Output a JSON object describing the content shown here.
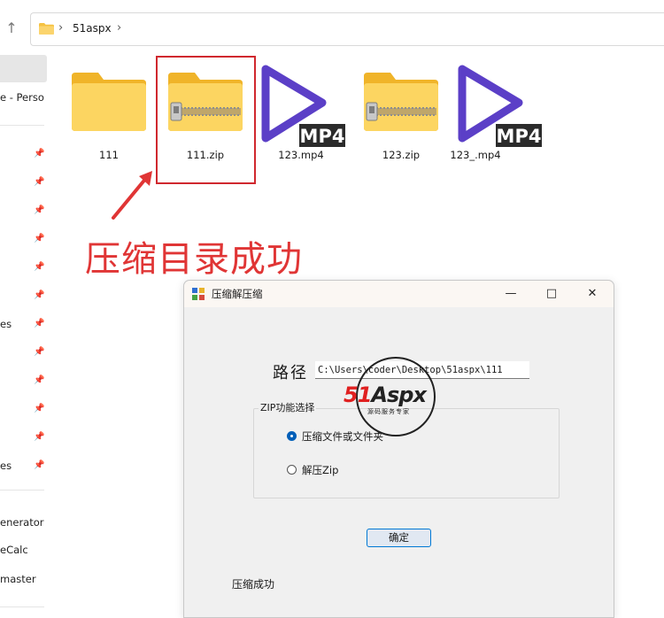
{
  "explorer": {
    "breadcrumb": "51aspx",
    "folder_color": "#f5c242",
    "sidebar": {
      "truncated_texts": [
        "e - Perso",
        "es",
        "es",
        "enerator",
        "eCalc",
        "master"
      ]
    },
    "files": [
      {
        "name": "111",
        "type": "folder"
      },
      {
        "name": "111.zip",
        "type": "zip-folder"
      },
      {
        "name": "123.mp4",
        "type": "mp4"
      },
      {
        "name": "123.zip",
        "type": "zip-folder"
      },
      {
        "name": "123_.mp4",
        "type": "mp4"
      }
    ],
    "mp4_badge": "MP4",
    "mp4_color": "#5b3fc7"
  },
  "annotation": {
    "text": "压缩目录成功",
    "color": "#e03535"
  },
  "dialog": {
    "title": "压缩解压缩",
    "path_label": "路径",
    "path_value": "C:\\Users\\coder\\Desktop\\51aspx\\111",
    "group_title": "ZIP功能选择",
    "option_compress": "压缩文件或文件夹",
    "option_extract": "解压Zip",
    "selected_option": "compress",
    "ok_label": "确定",
    "status": "压缩成功",
    "accent": "#0078d4"
  },
  "watermark": {
    "logo_num": "51",
    "logo_text": "Aspx",
    "subtitle": "源码服务专家"
  }
}
